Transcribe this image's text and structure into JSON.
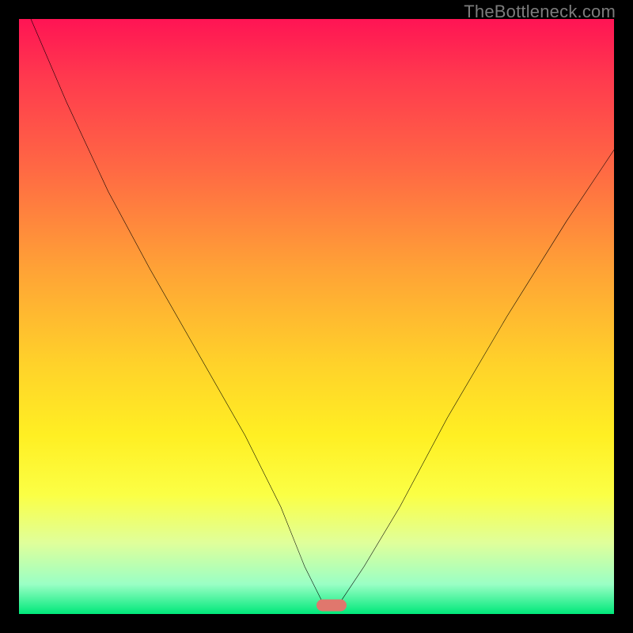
{
  "watermark": "TheBottleneck.com",
  "colors": {
    "frame": "#000000",
    "marker": "#e0776d"
  },
  "chart_data": {
    "type": "line",
    "title": "",
    "xlabel": "",
    "ylabel": "",
    "xlim": [
      0,
      100
    ],
    "ylim": [
      0,
      100
    ],
    "series": [
      {
        "name": "bottleneck-curve",
        "x": [
          2,
          8,
          15,
          22,
          30,
          38,
          44,
          48,
          51,
          54,
          58,
          64,
          72,
          82,
          92,
          100
        ],
        "y": [
          100,
          86,
          71,
          58,
          44,
          30,
          18,
          8,
          2,
          2,
          8,
          18,
          33,
          50,
          66,
          78
        ]
      }
    ],
    "annotations": [
      {
        "name": "min-marker",
        "x": 52.5,
        "y": 1.5
      }
    ]
  }
}
